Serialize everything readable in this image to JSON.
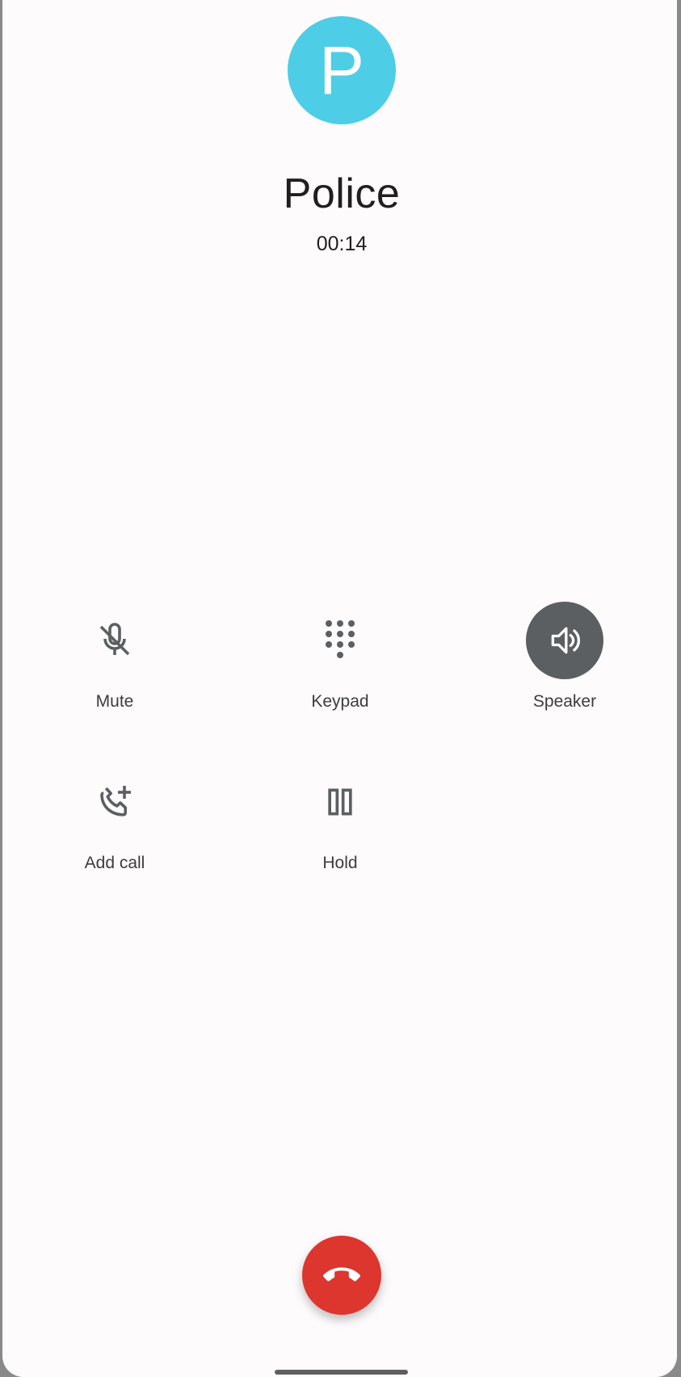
{
  "contact": {
    "initial": "P",
    "name": "Police",
    "duration": "00:14",
    "avatar_color": "#4ecde6"
  },
  "actions": [
    {
      "label": "Mute",
      "icon": "mic-off-icon",
      "active": false
    },
    {
      "label": "Keypad",
      "icon": "dialpad-icon",
      "active": false
    },
    {
      "label": "Speaker",
      "icon": "speaker-icon",
      "active": true
    },
    {
      "label": "Add call",
      "icon": "add-call-icon",
      "active": false
    },
    {
      "label": "Hold",
      "icon": "pause-icon",
      "active": false
    }
  ],
  "end_call": {
    "icon": "call-end-icon",
    "color": "#dc362e"
  },
  "colors": {
    "background": "#fefbfd",
    "icon": "#5c5f62",
    "active_bg": "#5c5f62"
  }
}
